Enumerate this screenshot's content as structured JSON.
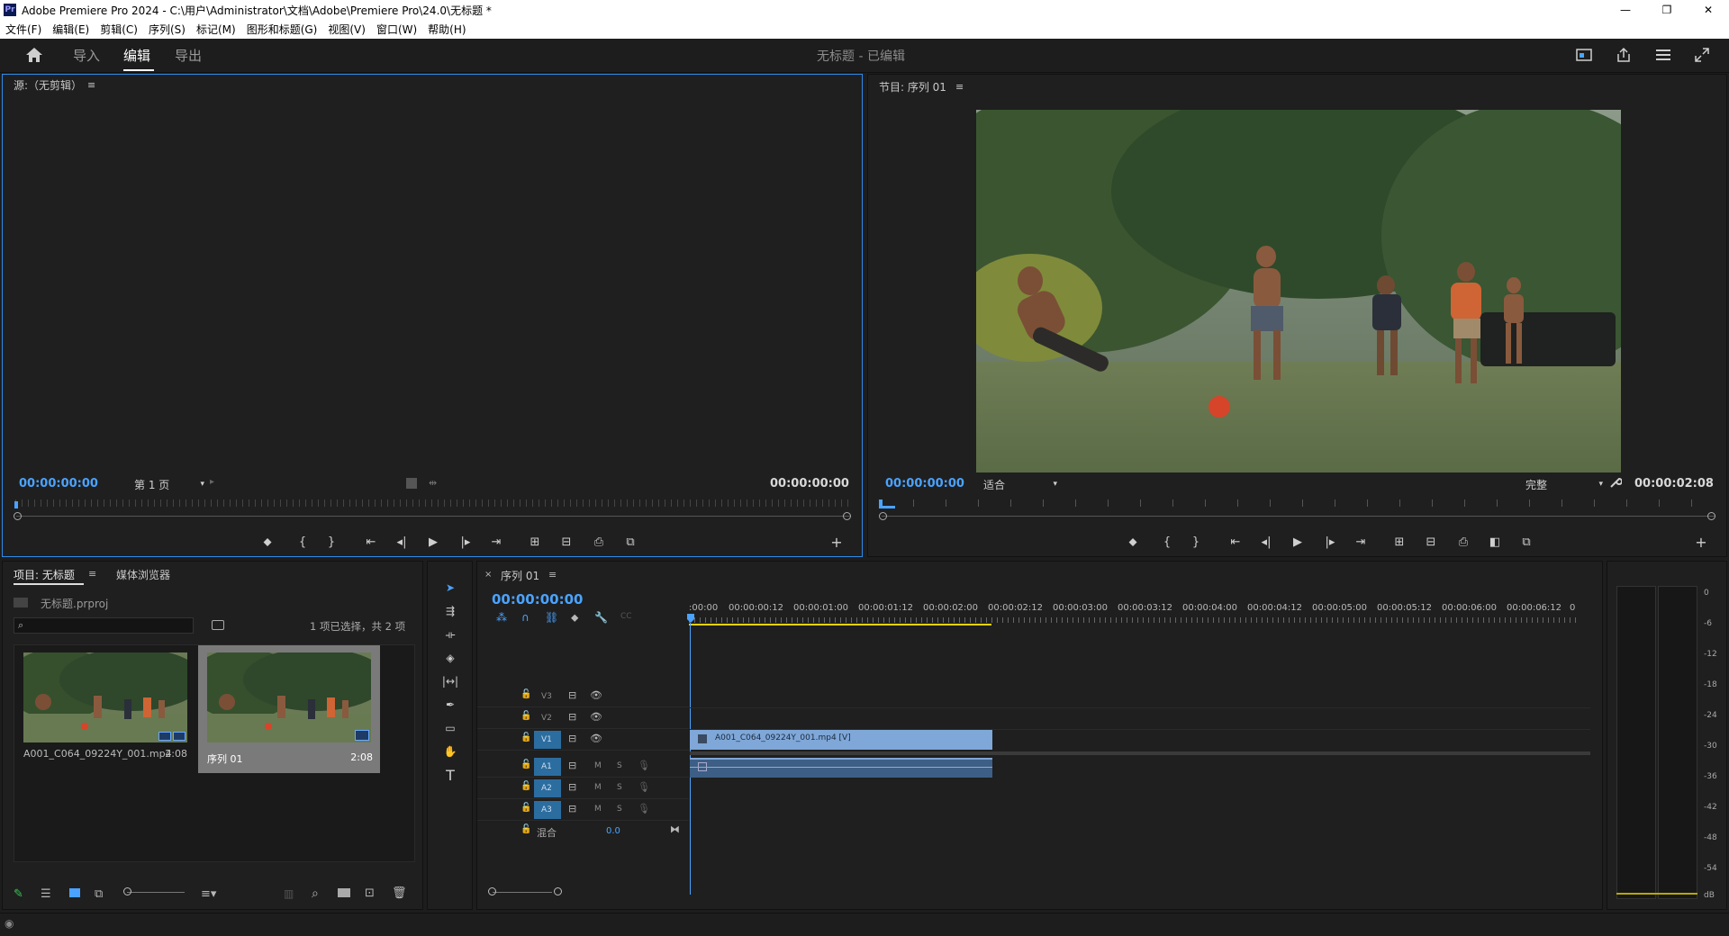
{
  "window": {
    "app_icon": "Pr",
    "title": "Adobe Premiere Pro 2024 - C:\\用户\\Administrator\\文档\\Adobe\\Premiere Pro\\24.0\\无标题 *",
    "controls": [
      "—",
      "❐",
      "✕"
    ]
  },
  "menu": [
    "文件(F)",
    "编辑(E)",
    "剪辑(C)",
    "序列(S)",
    "标记(M)",
    "图形和标题(G)",
    "视图(V)",
    "窗口(W)",
    "帮助(H)"
  ],
  "header": {
    "tabs": [
      "导入",
      "编辑",
      "导出"
    ],
    "active_tab": "编辑",
    "project_status": "无标题 - 已编辑"
  },
  "source_monitor": {
    "title": "源:（无剪辑）",
    "timecode_in": "00:00:00:00",
    "page_select": "第 1 页",
    "timecode_out": "00:00:00:00"
  },
  "program_monitor": {
    "title": "节目: 序列 01",
    "timecode_current": "00:00:00:00",
    "zoom_select": "适合",
    "quality_select": "完整",
    "timecode_duration": "00:00:02:08"
  },
  "project_panel": {
    "tab_project": "项目: 无标题",
    "tab_media": "媒体浏览器",
    "project_file": "无标题.prproj",
    "search_placeholder": "",
    "selection_status": "1 项已选择，共 2 项",
    "items": [
      {
        "name": "A001_C064_09224Y_001.mp4",
        "duration": "2:08"
      },
      {
        "name": "序列 01",
        "duration": "2:08"
      }
    ]
  },
  "timeline": {
    "tab": "序列 01",
    "timecode": "00:00:00:00",
    "ruler": [
      ":00:00",
      "00:00:00:12",
      "00:00:01:00",
      "00:00:01:12",
      "00:00:02:00",
      "00:00:02:12",
      "00:00:03:00",
      "00:00:03:12",
      "00:00:04:00",
      "00:00:04:12",
      "00:00:05:00",
      "00:00:05:12",
      "00:00:06:00",
      "00:00:06:12",
      "0"
    ],
    "video_tracks": [
      "V3",
      "V2",
      "V1"
    ],
    "audio_tracks": [
      "A1",
      "A2",
      "A3"
    ],
    "audio_buttons": {
      "mute": "M",
      "solo": "S"
    },
    "mix_label": "混合",
    "mix_value": "0.0",
    "clip_video_label": "A001_C064_09224Y_001.mp4 [V]"
  },
  "audio_meter": {
    "scale": [
      "0",
      "-6",
      "-12",
      "-18",
      "-24",
      "-30",
      "-36",
      "-42",
      "-48",
      "-54",
      "dB"
    ]
  },
  "colors": {
    "accent_blue": "#4aa3ff",
    "clip_video": "#7fa7d8",
    "clip_audio": "#3d5f86",
    "track_target": "#2c6da0",
    "work_area": "#e6d300"
  }
}
